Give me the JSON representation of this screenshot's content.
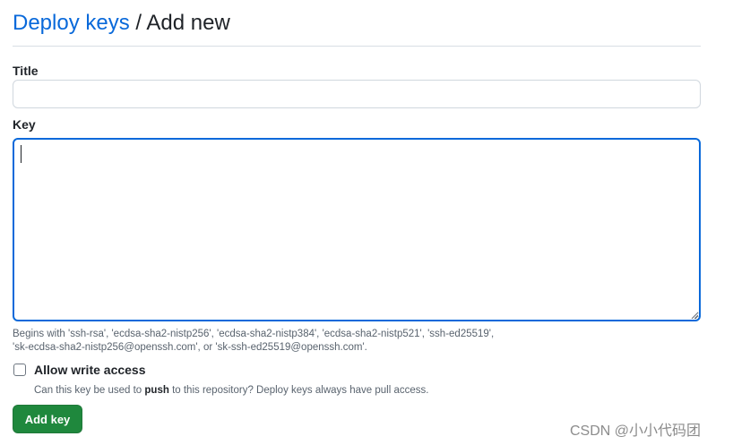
{
  "header": {
    "link_text": "Deploy keys",
    "separator": "/",
    "current": "Add new",
    "link_color": "#0969da"
  },
  "form": {
    "title_label": "Title",
    "title_value": "",
    "key_label": "Key",
    "key_value": "",
    "focus_color": "#0969da",
    "hint_line1": "Begins with 'ssh-rsa', 'ecdsa-sha2-nistp256', 'ecdsa-sha2-nistp384', 'ecdsa-sha2-nistp521', 'ssh-ed25519',",
    "hint_line2": "'sk-ecdsa-sha2-nistp256@openssh.com', or 'sk-ssh-ed25519@openssh.com'.",
    "checkbox_label": "Allow write access",
    "checkbox_checked": false,
    "note_pre": "Can this key be used to ",
    "note_bold": "push",
    "note_post": " to this repository? Deploy keys always have pull access.",
    "submit_label": "Add key",
    "submit_color": "#1f883d"
  },
  "watermark": "CSDN @小小代码团"
}
